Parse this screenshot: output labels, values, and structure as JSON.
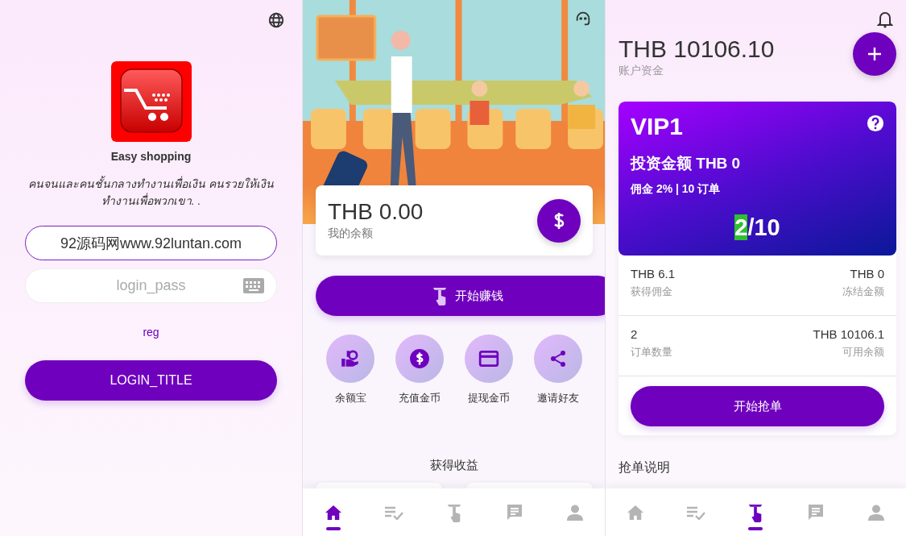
{
  "login": {
    "app_name": "Easy shopping",
    "slogan": "คนจนและคนชั้นกลางทำงานเพื่อเงิน คนรวยให้เงินทำงานเพื่อพวกเขา. .",
    "username": {
      "value": "92源码网www.92luntan.com"
    },
    "password": {
      "placeholder": "login_pass"
    },
    "register_link": "reg",
    "login_button": "LOGIN_TITLE"
  },
  "home": {
    "balance": {
      "amount": "THB 0.00",
      "label": "我的余额"
    },
    "start_button": "开始赚钱",
    "actions": [
      {
        "kind": "wallet",
        "label": "余额宝"
      },
      {
        "kind": "dollar",
        "label": "充值金币"
      },
      {
        "kind": "card",
        "label": "提现金币"
      },
      {
        "kind": "share",
        "label": "邀请好友"
      }
    ],
    "section_title": "获得收益",
    "nav": [
      {
        "kind": "home",
        "selected": true
      },
      {
        "kind": "tasks",
        "selected": false
      },
      {
        "kind": "grab",
        "selected": false
      },
      {
        "kind": "messages",
        "selected": false
      },
      {
        "kind": "profile",
        "selected": false
      }
    ]
  },
  "orders": {
    "account": {
      "amount": "THB 10106.10",
      "label": "账户资金"
    },
    "vip": {
      "level": "VIP1",
      "invest": "投资金额 THB 0",
      "terms": "佣金 2% | 10 订单",
      "progress_done": "2",
      "progress_done_highlighted": true,
      "progress_total": "/10"
    },
    "stats": [
      {
        "value": "THB 6.1",
        "label": "获得佣金"
      },
      {
        "value": "THB 0",
        "label": "冻结金额"
      },
      {
        "value": "2",
        "label": "订单数量"
      },
      {
        "value": "THB 10106.1",
        "label": "可用余额"
      }
    ],
    "grab_button": "开始抢单",
    "notes_title": "抢单说明",
    "nav": [
      {
        "kind": "home",
        "selected": false
      },
      {
        "kind": "tasks",
        "selected": false
      },
      {
        "kind": "grab",
        "selected": true
      },
      {
        "kind": "messages",
        "selected": false
      },
      {
        "kind": "profile",
        "selected": false
      }
    ]
  }
}
